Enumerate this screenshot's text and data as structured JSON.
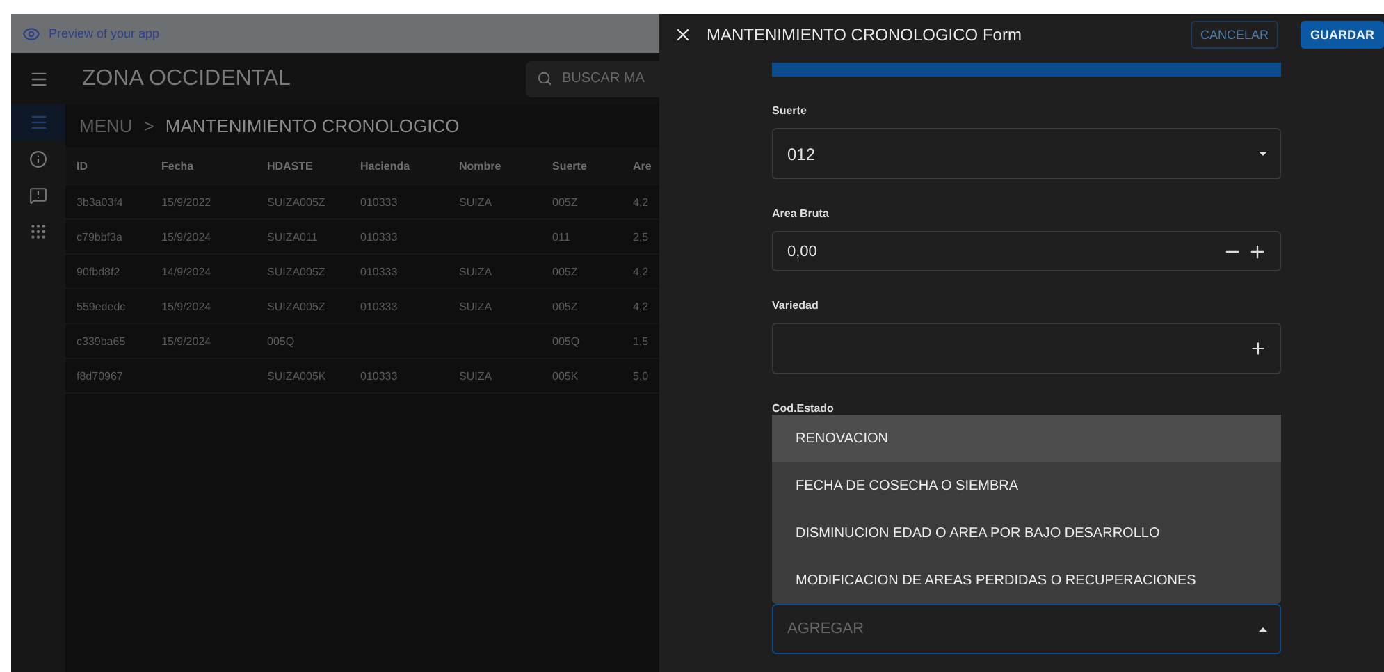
{
  "preview_bar": {
    "text": "Preview of your app"
  },
  "header": {
    "title": "ZONA OCCIDENTAL",
    "search": {
      "placeholder": "BUSCAR MA"
    }
  },
  "sidebar": {
    "items": [
      {
        "selected": true
      },
      {
        "selected": false
      },
      {
        "selected": false
      },
      {
        "selected": false
      }
    ]
  },
  "breadcrumb": {
    "root": "MENU",
    "separator": ">",
    "current": "MANTENIMIENTO CRONOLOGICO"
  },
  "table": {
    "columns": [
      "ID",
      "Fecha",
      "HDASTE",
      "Hacienda",
      "Nombre",
      "Suerte",
      "Are"
    ],
    "rows": [
      [
        "3b3a03f4",
        "15/9/2022",
        "SUIZA005Z",
        "010333",
        "SUIZA",
        "005Z",
        "4,2"
      ],
      [
        "c79bbf3a",
        "15/9/2024",
        "SUIZA011",
        "010333",
        "",
        "011",
        "2,5"
      ],
      [
        "90fbd8f2",
        "14/9/2024",
        "SUIZA005Z",
        "010333",
        "SUIZA",
        "005Z",
        "4,2"
      ],
      [
        "559ededc",
        "15/9/2024",
        "SUIZA005Z",
        "010333",
        "SUIZA",
        "005Z",
        "4,2"
      ],
      [
        "c339ba65",
        "15/9/2024",
        "005Q",
        "",
        "",
        "005Q",
        "1,5"
      ],
      [
        "f8d70967",
        "",
        "SUIZA005K",
        "010333",
        "SUIZA",
        "005K",
        "5,0"
      ]
    ]
  },
  "form": {
    "title": "MANTENIMIENTO CRONOLOGICO Form",
    "buttons": [
      {
        "label": "CANCELAR",
        "kind": "outlined"
      },
      {
        "label": "GUARDAR",
        "kind": "filled"
      }
    ],
    "fields": [
      {
        "label": "Suerte",
        "kind": "select",
        "value": "012"
      },
      {
        "label": "Area Bruta",
        "kind": "number",
        "value": "0,00"
      },
      {
        "label": "Variedad",
        "kind": "add"
      },
      {
        "label": "Cod.Estado",
        "kind": "open-select",
        "placeholder": "AGREGAR",
        "options": [
          {
            "label": "RENOVACION",
            "selected": true
          },
          {
            "label": "FECHA DE COSECHA O SIEMBRA",
            "selected": false
          },
          {
            "label": "DISMINUCION EDAD O AREA POR BAJO DESARROLLO",
            "selected": false
          },
          {
            "label": "MODIFICACION DE AREAS PERDIDAS O RECUPERACIONES",
            "selected": false
          }
        ]
      }
    ]
  }
}
